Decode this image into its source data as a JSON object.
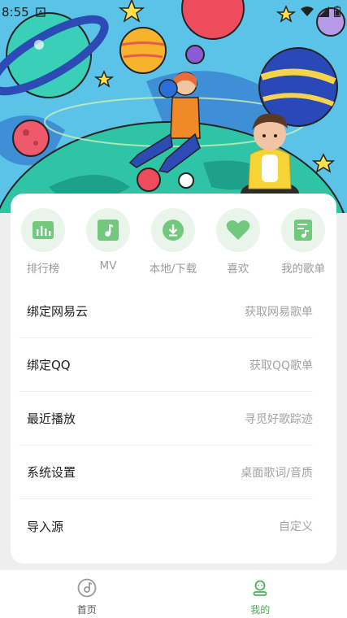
{
  "status": {
    "time": "8:55"
  },
  "quick_actions": [
    {
      "label": "排行榜",
      "icon": "chart-bars-icon"
    },
    {
      "label": "MV",
      "icon": "music-note-icon"
    },
    {
      "label": "本地/下载",
      "icon": "download-icon"
    },
    {
      "label": "喜欢",
      "icon": "heart-icon"
    },
    {
      "label": "我的歌单",
      "icon": "playlist-icon"
    }
  ],
  "menu": [
    {
      "title": "绑定网易云",
      "hint": "获取网易歌单"
    },
    {
      "title": "绑定QQ",
      "hint": "获取QQ歌单"
    },
    {
      "title": "最近播放",
      "hint": "寻觅好歌踪迹"
    },
    {
      "title": "系统设置",
      "hint": "桌面歌词/音质"
    },
    {
      "title": "导入源",
      "hint": "自定义"
    }
  ],
  "tabs": [
    {
      "label": "首页",
      "icon": "disc-icon",
      "active": false
    },
    {
      "label": "我的",
      "icon": "profile-icon",
      "active": true
    }
  ],
  "colors": {
    "accent": "#4caf50",
    "icon_bg": "#e9f5ea",
    "icon_fg": "#72c97e"
  }
}
